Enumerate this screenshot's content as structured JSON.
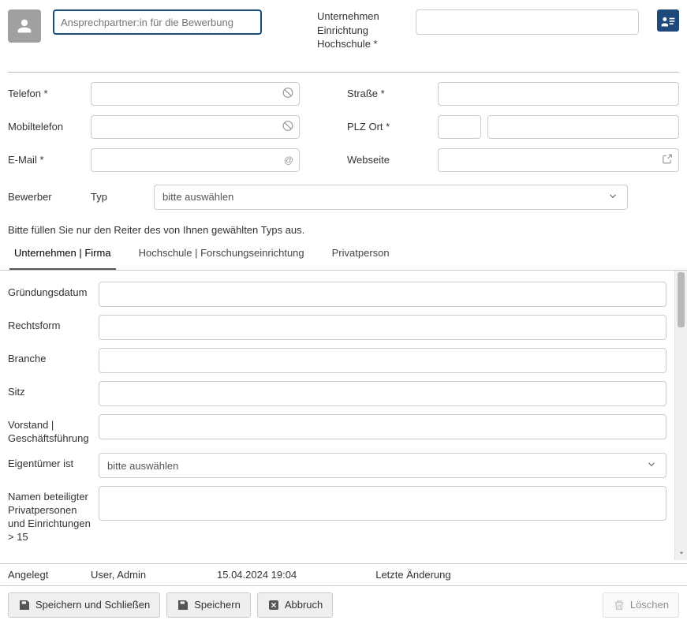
{
  "top": {
    "contact_placeholder": "Ansprechpartner:in für die Bewerbung",
    "company_label_line1": "Unternehmen",
    "company_label_line2": "Einrichtung",
    "company_label_line3": "Hochschule *"
  },
  "fields": {
    "telefon_label": "Telefon *",
    "mobil_label": "Mobiltelefon",
    "email_label": "E-Mail *",
    "strasse_label": "Straße *",
    "plzort_label": "PLZ Ort *",
    "webseite_label": "Webseite"
  },
  "type_row": {
    "bewerber_label": "Bewerber",
    "typ_label": "Typ",
    "typ_placeholder": "bitte auswählen"
  },
  "hint": "Bitte füllen Sie nur den Reiter des von Ihnen gewählten Typs aus.",
  "tabs": {
    "t1": "Unternehmen | Firma",
    "t2": "Hochschule | Forschungseinrichtung",
    "t3": "Privatperson"
  },
  "details": {
    "gruendung_label": "Gründungsdatum",
    "rechtsform_label": "Rechtsform",
    "branche_label": "Branche",
    "sitz_label": "Sitz",
    "vorstand_label": "Vorstand | Geschäftsführung",
    "eigentuemer_label": "Eigentümer ist",
    "eigentuemer_placeholder": "bitte auswählen",
    "namen_label": "Namen beteiligter Privatpersonen und Einrichtungen > 15"
  },
  "meta": {
    "angelegt_label": "Angelegt",
    "user": "User, Admin",
    "date": "15.04.2024 19:04",
    "change_label": "Letzte Änderung"
  },
  "actions": {
    "save_close": "Speichern und Schließen",
    "save": "Speichern",
    "cancel": "Abbruch",
    "delete": "Löschen"
  },
  "icons": {
    "at": "@"
  }
}
